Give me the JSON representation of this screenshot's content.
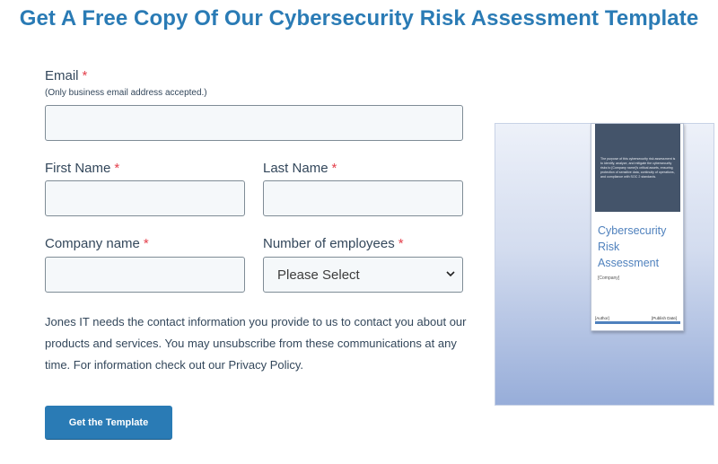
{
  "page": {
    "title": "Get A Free Copy Of Our Cybersecurity Risk Assessment Template"
  },
  "form": {
    "required_marker": "*",
    "email": {
      "label": "Email",
      "hint": "(Only business email address accepted.)",
      "value": ""
    },
    "first_name": {
      "label": "First Name",
      "value": ""
    },
    "last_name": {
      "label": "Last Name",
      "value": ""
    },
    "company": {
      "label": "Company name",
      "value": ""
    },
    "employees": {
      "label": "Number of employees",
      "selected": "Please Select"
    },
    "notice": "Jones IT needs the contact information you provide to us to contact you about our products and services. You may unsubscribe from these communications at any time. For information check out our Privacy Policy.",
    "submit_label": "Get the Template"
  },
  "cover": {
    "band_text": "The purpose of this cybersecurity risk assessment is to identify, analyze, and mitigate the cybersecurity risks to [Company name]'s critical assets, ensuring protection of sensitive data, continuity of operations, and compliance with SOC 2 standards.",
    "title_line1": "Cybersecurity",
    "title_line2": "Risk",
    "title_line3": "Assessment",
    "company": "[Company]",
    "author": "[Author]",
    "date": "[Publish Date]"
  },
  "colors": {
    "accent": "#2a7bb5",
    "required": "#e4414d",
    "text": "#33475b",
    "cover_band": "#44546a",
    "cover_title": "#4f81bd"
  }
}
